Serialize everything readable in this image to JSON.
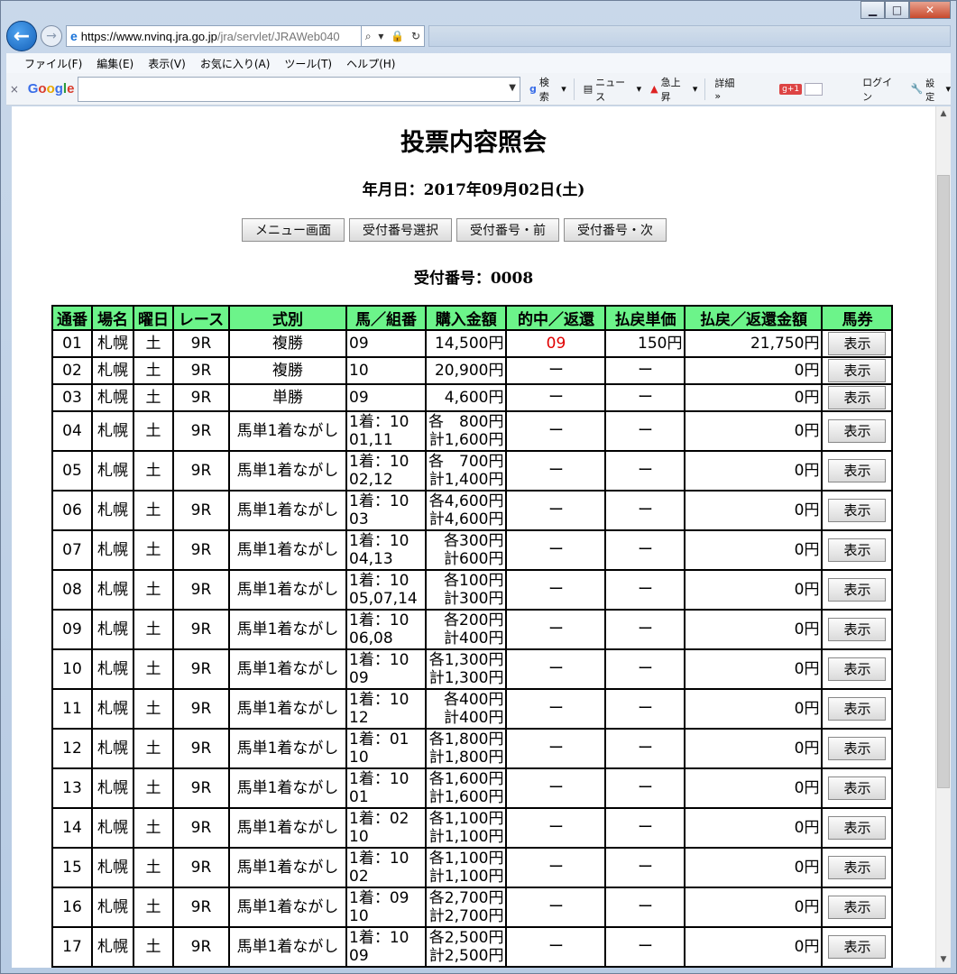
{
  "browser": {
    "url_main": "https://www.nvinq.jra.go.jp",
    "url_rest": "/jra/servlet/JRAWeb040",
    "menu": [
      "ファイル(F)",
      "編集(E)",
      "表示(V)",
      "お気に入り(A)",
      "ツール(T)",
      "ヘルプ(H)"
    ],
    "toolbar": {
      "search_label": "検索",
      "news_label": "ニュース",
      "trending_label": "急上昇",
      "details_label": "詳細 »",
      "login_label": "ログイン",
      "settings_label": "設定"
    }
  },
  "page": {
    "title": "投票内容照会",
    "date_line": "年月日：2017年09月02日(土)",
    "buttons": [
      "メニュー画面",
      "受付番号選択",
      "受付番号・前",
      "受付番号・次"
    ],
    "receipt_line": "受付番号：0008"
  },
  "table": {
    "headers": [
      "通番",
      "場名",
      "曜日",
      "レース",
      "式別",
      "馬／組番",
      "購入金額",
      "的中／返還",
      "払戻単価",
      "払戻／返還金額",
      "馬券"
    ],
    "rows": [
      {
        "no": "01",
        "venue": "札幌",
        "day": "土",
        "race": "9R",
        "type": "複勝",
        "kumi": [
          "09"
        ],
        "amount": [
          "14,500円"
        ],
        "hit": "09",
        "unit": "150円",
        "payout": "21,750円",
        "btn": "表示"
      },
      {
        "no": "02",
        "venue": "札幌",
        "day": "土",
        "race": "9R",
        "type": "複勝",
        "kumi": [
          "10"
        ],
        "amount": [
          "20,900円"
        ],
        "hit": "ー",
        "unit": "ー",
        "payout": "0円",
        "btn": "表示"
      },
      {
        "no": "03",
        "venue": "札幌",
        "day": "土",
        "race": "9R",
        "type": "単勝",
        "kumi": [
          "09"
        ],
        "amount": [
          "4,600円"
        ],
        "hit": "ー",
        "unit": "ー",
        "payout": "0円",
        "btn": "表示"
      },
      {
        "no": "04",
        "venue": "札幌",
        "day": "土",
        "race": "9R",
        "type": "馬単1着ながし",
        "kumi": [
          "1着：10",
          "01,11"
        ],
        "amount": [
          "各　800円",
          "計1,600円"
        ],
        "hit": "ー",
        "unit": "ー",
        "payout": "0円",
        "btn": "表示"
      },
      {
        "no": "05",
        "venue": "札幌",
        "day": "土",
        "race": "9R",
        "type": "馬単1着ながし",
        "kumi": [
          "1着：10",
          "02,12"
        ],
        "amount": [
          "各　700円",
          "計1,400円"
        ],
        "hit": "ー",
        "unit": "ー",
        "payout": "0円",
        "btn": "表示"
      },
      {
        "no": "06",
        "venue": "札幌",
        "day": "土",
        "race": "9R",
        "type": "馬単1着ながし",
        "kumi": [
          "1着：10",
          "03"
        ],
        "amount": [
          "各4,600円",
          "計4,600円"
        ],
        "hit": "ー",
        "unit": "ー",
        "payout": "0円",
        "btn": "表示"
      },
      {
        "no": "07",
        "venue": "札幌",
        "day": "土",
        "race": "9R",
        "type": "馬単1着ながし",
        "kumi": [
          "1着：10",
          "04,13"
        ],
        "amount": [
          "各300円",
          "計600円"
        ],
        "hit": "ー",
        "unit": "ー",
        "payout": "0円",
        "btn": "表示"
      },
      {
        "no": "08",
        "venue": "札幌",
        "day": "土",
        "race": "9R",
        "type": "馬単1着ながし",
        "kumi": [
          "1着：10",
          "05,07,14"
        ],
        "amount": [
          "各100円",
          "計300円"
        ],
        "hit": "ー",
        "unit": "ー",
        "payout": "0円",
        "btn": "表示"
      },
      {
        "no": "09",
        "venue": "札幌",
        "day": "土",
        "race": "9R",
        "type": "馬単1着ながし",
        "kumi": [
          "1着：10",
          "06,08"
        ],
        "amount": [
          "各200円",
          "計400円"
        ],
        "hit": "ー",
        "unit": "ー",
        "payout": "0円",
        "btn": "表示"
      },
      {
        "no": "10",
        "venue": "札幌",
        "day": "土",
        "race": "9R",
        "type": "馬単1着ながし",
        "kumi": [
          "1着：10",
          "09"
        ],
        "amount": [
          "各1,300円",
          "計1,300円"
        ],
        "hit": "ー",
        "unit": "ー",
        "payout": "0円",
        "btn": "表示"
      },
      {
        "no": "11",
        "venue": "札幌",
        "day": "土",
        "race": "9R",
        "type": "馬単1着ながし",
        "kumi": [
          "1着：10",
          "12"
        ],
        "amount": [
          "各400円",
          "計400円"
        ],
        "hit": "ー",
        "unit": "ー",
        "payout": "0円",
        "btn": "表示"
      },
      {
        "no": "12",
        "venue": "札幌",
        "day": "土",
        "race": "9R",
        "type": "馬単1着ながし",
        "kumi": [
          "1着：01",
          "10"
        ],
        "amount": [
          "各1,800円",
          "計1,800円"
        ],
        "hit": "ー",
        "unit": "ー",
        "payout": "0円",
        "btn": "表示"
      },
      {
        "no": "13",
        "venue": "札幌",
        "day": "土",
        "race": "9R",
        "type": "馬単1着ながし",
        "kumi": [
          "1着：10",
          "01"
        ],
        "amount": [
          "各1,600円",
          "計1,600円"
        ],
        "hit": "ー",
        "unit": "ー",
        "payout": "0円",
        "btn": "表示"
      },
      {
        "no": "14",
        "venue": "札幌",
        "day": "土",
        "race": "9R",
        "type": "馬単1着ながし",
        "kumi": [
          "1着：02",
          "10"
        ],
        "amount": [
          "各1,100円",
          "計1,100円"
        ],
        "hit": "ー",
        "unit": "ー",
        "payout": "0円",
        "btn": "表示"
      },
      {
        "no": "15",
        "venue": "札幌",
        "day": "土",
        "race": "9R",
        "type": "馬単1着ながし",
        "kumi": [
          "1着：10",
          "02"
        ],
        "amount": [
          "各1,100円",
          "計1,100円"
        ],
        "hit": "ー",
        "unit": "ー",
        "payout": "0円",
        "btn": "表示"
      },
      {
        "no": "16",
        "venue": "札幌",
        "day": "土",
        "race": "9R",
        "type": "馬単1着ながし",
        "kumi": [
          "1着：09",
          "10"
        ],
        "amount": [
          "各2,700円",
          "計2,700円"
        ],
        "hit": "ー",
        "unit": "ー",
        "payout": "0円",
        "btn": "表示"
      },
      {
        "no": "17",
        "venue": "札幌",
        "day": "土",
        "race": "9R",
        "type": "馬単1着ながし",
        "kumi": [
          "1着：10",
          "09"
        ],
        "amount": [
          "各2,500円",
          "計2,500円"
        ],
        "hit": "ー",
        "unit": "ー",
        "payout": "0円",
        "btn": "表示"
      }
    ]
  },
  "colors": {
    "header_bg": "#6cf48a",
    "hit_text": "#e00000"
  }
}
